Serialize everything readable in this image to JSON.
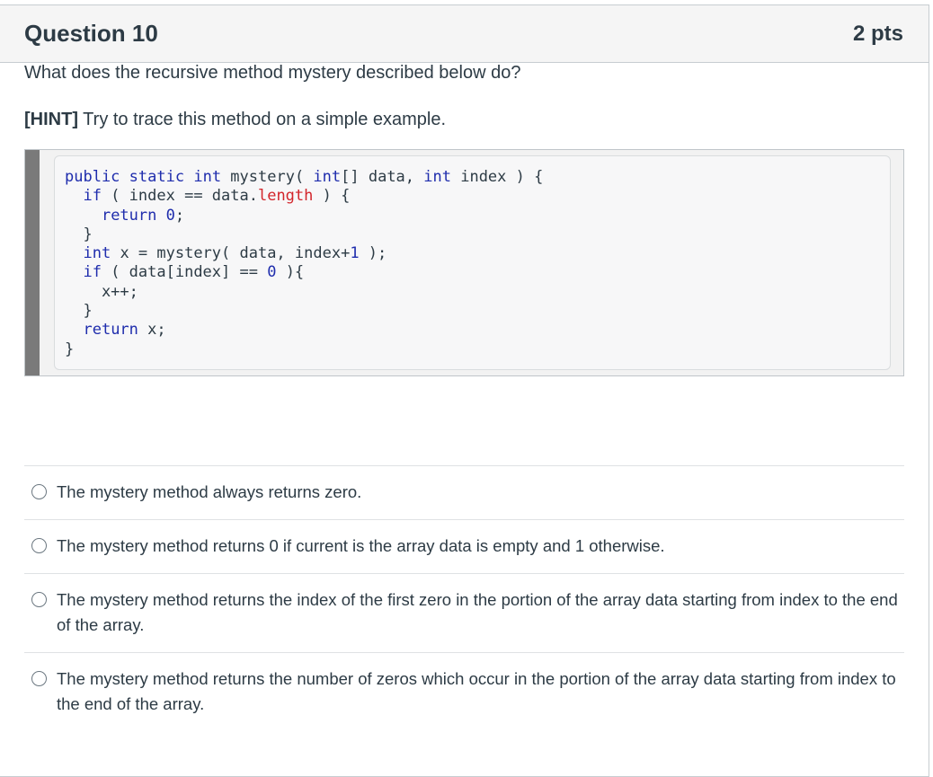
{
  "question": {
    "title": "Question 10",
    "points": "2 pts",
    "prompt": "What does the recursive method mystery described below do?",
    "hint_tag": "[HINT]",
    "hint_text": " Try to trace this method on a simple example."
  },
  "code": {
    "lines": [
      "public static int mystery( int[] data, int index ) {",
      "  if ( index == data.length ) {",
      "    return 0;",
      "  }",
      "  int x = mystery( data, index+1 );",
      "  if ( data[index] == 0 ){",
      "    x++;",
      "  }",
      "  return x;",
      "}"
    ]
  },
  "options": [
    {
      "label": "The mystery method always returns zero."
    },
    {
      "label": "The mystery method returns 0 if current is the array data is empty and 1 otherwise."
    },
    {
      "label": "The mystery method returns the index of the first zero in the portion of the array data starting from index to the end of the array."
    },
    {
      "label": "The mystery method returns the number of zeros which occur in the portion of the array data starting from index to the end of the array."
    }
  ],
  "colors": {
    "text": "#2d3b45",
    "header_bg": "#f5f5f5",
    "keyword": "#1f2dad",
    "code_highlight": "#d2252b",
    "code_bar": "#7a7a7a"
  }
}
